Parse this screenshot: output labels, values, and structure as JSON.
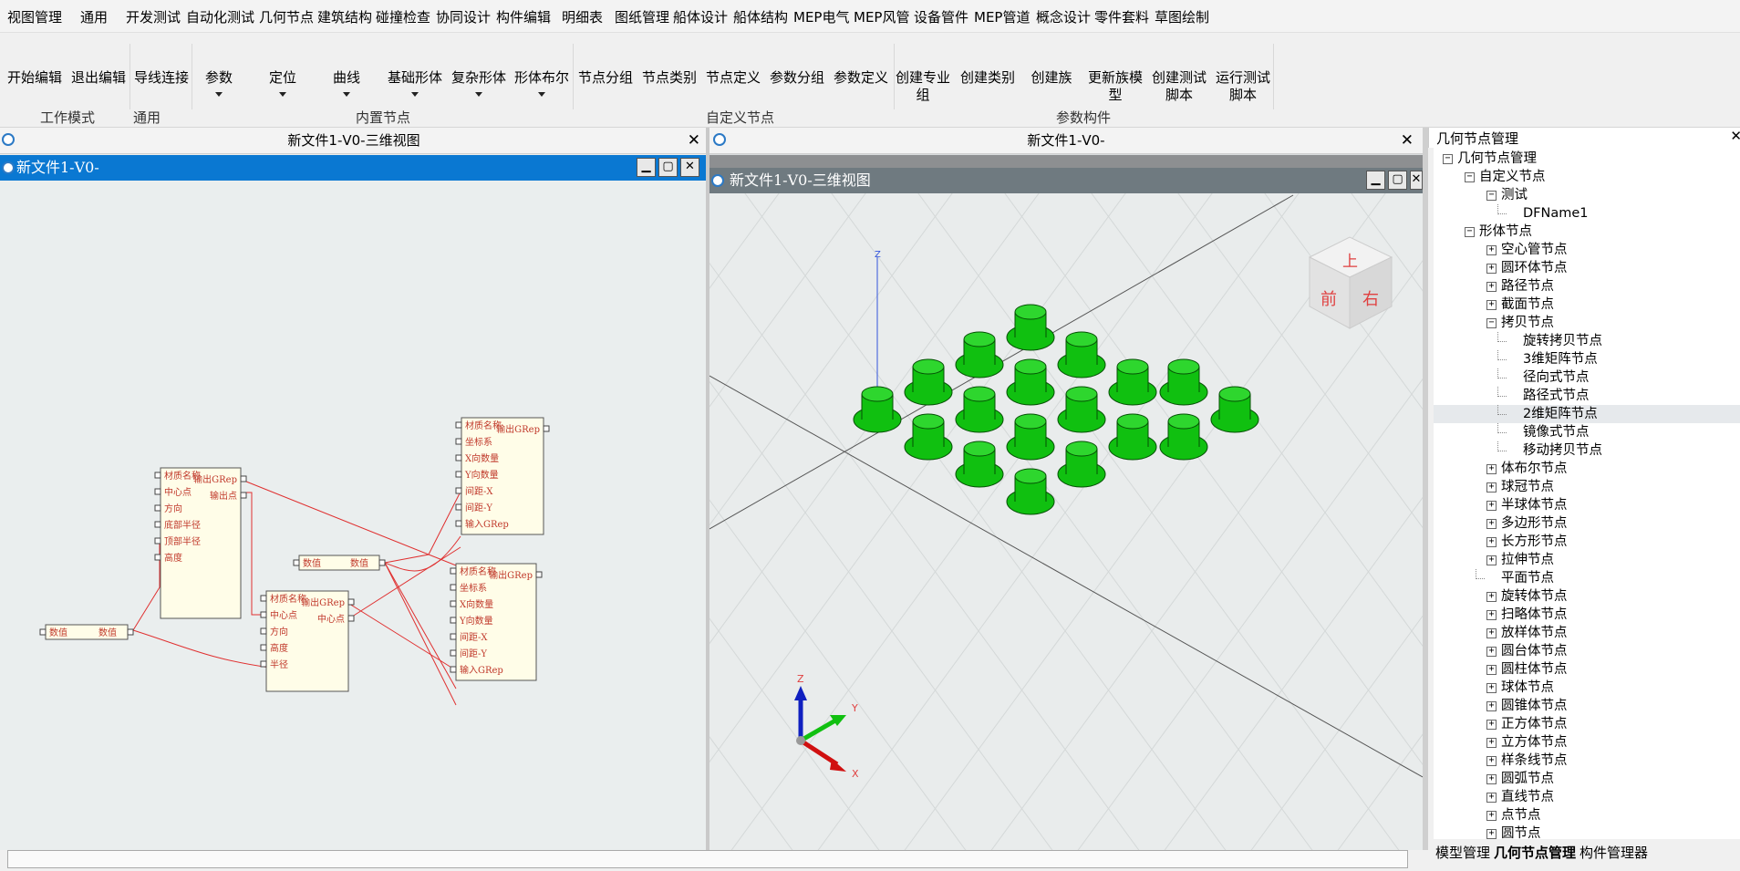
{
  "menu": [
    "视图管理",
    "通用",
    "开发测试",
    "自动化测试",
    "几何节点",
    "建筑结构",
    "碰撞检查",
    "协同设计",
    "构件编辑",
    "明细表",
    "图纸管理",
    "船体设计",
    "船体结构",
    "MEP电气",
    "MEP风管",
    "设备管件",
    "MEP管道",
    "概念设计",
    "零件套料",
    "草图绘制"
  ],
  "ribbon": {
    "buttons": [
      {
        "label": "开始编辑"
      },
      {
        "label": "退出编辑"
      },
      {
        "label": "导线连接"
      },
      {
        "label": "参数",
        "dropdown": true
      },
      {
        "label": "定位",
        "dropdown": true
      },
      {
        "label": "曲线",
        "dropdown": true
      },
      {
        "label": "基础形体",
        "dropdown": true
      },
      {
        "label": "复杂形体",
        "dropdown": true
      },
      {
        "label": "形体布尔",
        "dropdown": true
      },
      {
        "label": "节点分组"
      },
      {
        "label": "节点类别"
      },
      {
        "label": "节点定义"
      },
      {
        "label": "参数分组"
      },
      {
        "label": "参数定义"
      },
      {
        "label": "创建专业\n组"
      },
      {
        "label": "创建类别"
      },
      {
        "label": "创建族"
      },
      {
        "label": "更新族模\n型"
      },
      {
        "label": "创建测试\n脚本"
      },
      {
        "label": "运行测试\n脚本"
      }
    ],
    "groups": [
      "工作模式",
      "通用",
      "内置节点",
      "自定义节点",
      "参数构件"
    ]
  },
  "left_panel": {
    "title": "新文件1-V0-三维视图",
    "mdi_title": "新文件1-V0-"
  },
  "right_panel": {
    "title": "新文件1-V0-",
    "mdi_title": "新文件1-V0-三维视图"
  },
  "nodes": {
    "num_label": "数值",
    "n1": {
      "inputs": [
        "材质名称",
        "中心点",
        "方向",
        "底部半径",
        "顶部半径",
        "高度"
      ],
      "outputs": [
        "输出GRep",
        "输出点"
      ]
    },
    "n2": {
      "inputs": [
        "材质名称",
        "中心点",
        "方向",
        "高度",
        "半径"
      ],
      "outputs": [
        "输出GRep",
        "中心点"
      ]
    },
    "n3": {
      "inputs": [
        "材质名称",
        "坐标系",
        "X向数量",
        "Y向数量",
        "间距-X",
        "间距-Y",
        "输入GRep"
      ],
      "outputs": [
        "输出GRep"
      ]
    },
    "n4": {
      "inputs": [
        "材质名称",
        "坐标系",
        "X向数量",
        "Y向数量",
        "间距-X",
        "间距-Y",
        "输入GRep"
      ],
      "outputs": [
        "输出GRep"
      ]
    }
  },
  "viewcube": {
    "top": "上",
    "front": "前",
    "right": "右"
  },
  "axes": {
    "x": "X",
    "y": "Y",
    "z": "Z"
  },
  "tree": {
    "title": "几何节点管理",
    "nodes": [
      {
        "label": "几何节点管理",
        "level": 0,
        "box": "-"
      },
      {
        "label": "自定义节点",
        "level": 1,
        "box": "-"
      },
      {
        "label": "测试",
        "level": 2,
        "box": "-"
      },
      {
        "label": "DFName1",
        "level": 3,
        "box": ""
      },
      {
        "label": "形体节点",
        "level": 1,
        "box": "-"
      },
      {
        "label": "空心管节点",
        "level": 2,
        "box": "+"
      },
      {
        "label": "圆环体节点",
        "level": 2,
        "box": "+"
      },
      {
        "label": "路径节点",
        "level": 2,
        "box": "+"
      },
      {
        "label": "截面节点",
        "level": 2,
        "box": "+"
      },
      {
        "label": "拷贝节点",
        "level": 2,
        "box": "-"
      },
      {
        "label": "旋转拷贝节点",
        "level": 3,
        "box": ""
      },
      {
        "label": "3维矩阵节点",
        "level": 3,
        "box": ""
      },
      {
        "label": "径向式节点",
        "level": 3,
        "box": ""
      },
      {
        "label": "路径式节点",
        "level": 3,
        "box": ""
      },
      {
        "label": "2维矩阵节点",
        "level": 3,
        "box": "",
        "selected": true
      },
      {
        "label": "镜像式节点",
        "level": 3,
        "box": ""
      },
      {
        "label": "移动拷贝节点",
        "level": 3,
        "box": ""
      },
      {
        "label": "体布尔节点",
        "level": 2,
        "box": "+"
      },
      {
        "label": "球冠节点",
        "level": 2,
        "box": "+"
      },
      {
        "label": "半球体节点",
        "level": 2,
        "box": "+"
      },
      {
        "label": "多边形节点",
        "level": 2,
        "box": "+"
      },
      {
        "label": "长方形节点",
        "level": 2,
        "box": "+"
      },
      {
        "label": "拉伸节点",
        "level": 2,
        "box": "+"
      },
      {
        "label": "平面节点",
        "level": 2,
        "box": ""
      },
      {
        "label": "旋转体节点",
        "level": 2,
        "box": "+"
      },
      {
        "label": "扫略体节点",
        "level": 2,
        "box": "+"
      },
      {
        "label": "放样体节点",
        "level": 2,
        "box": "+"
      },
      {
        "label": "圆台体节点",
        "level": 2,
        "box": "+"
      },
      {
        "label": "圆柱体节点",
        "level": 2,
        "box": "+"
      },
      {
        "label": "球体节点",
        "level": 2,
        "box": "+"
      },
      {
        "label": "圆锥体节点",
        "level": 2,
        "box": "+"
      },
      {
        "label": "正方体节点",
        "level": 2,
        "box": "+"
      },
      {
        "label": "立方体节点",
        "level": 2,
        "box": "+"
      },
      {
        "label": "样条线节点",
        "level": 2,
        "box": "+"
      },
      {
        "label": "圆弧节点",
        "level": 2,
        "box": "+"
      },
      {
        "label": "直线节点",
        "level": 2,
        "box": "+"
      },
      {
        "label": "点节点",
        "level": 2,
        "box": "+"
      },
      {
        "label": "圆节点",
        "level": 2,
        "box": "+"
      }
    ]
  },
  "bottom_tabs": [
    "模型管理",
    "几何节点管理",
    "构件管理器"
  ],
  "colors": {
    "wire": "#e03030",
    "accent": "#0078d7",
    "mdi_active": "#0a78d2",
    "mdi_inactive": "#6f7a80",
    "hat": "#10c010"
  }
}
